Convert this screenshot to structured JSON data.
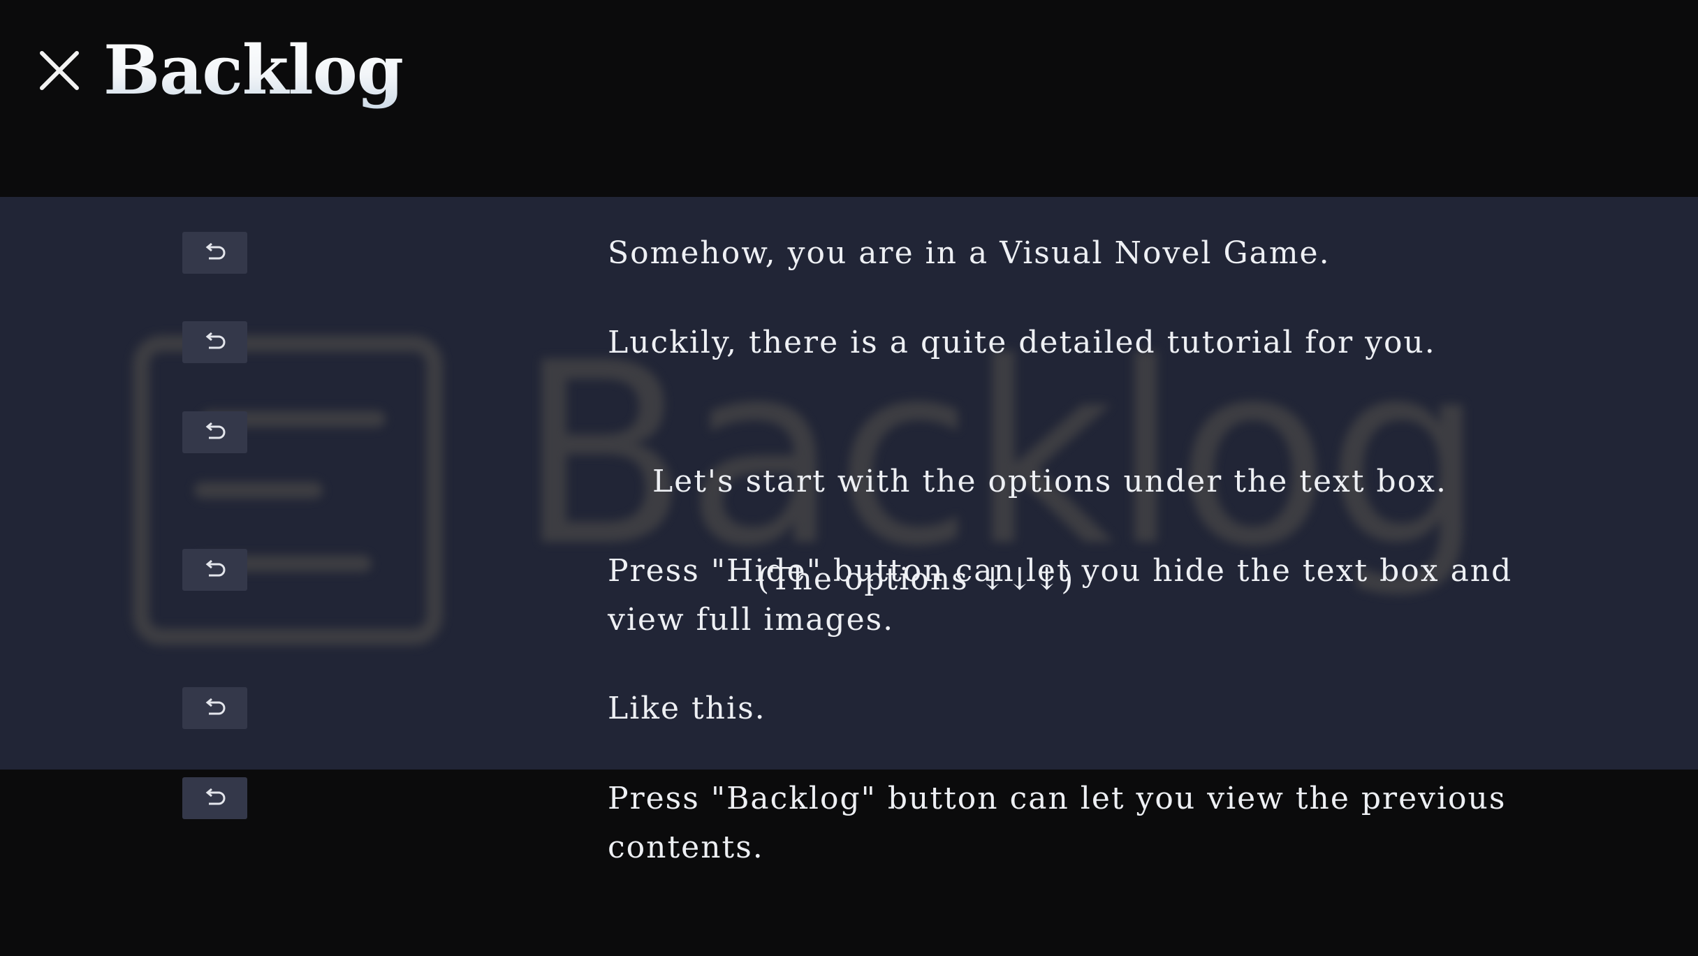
{
  "header": {
    "title": "Backlog",
    "close_icon": "close-icon"
  },
  "watermark": {
    "text": "Backlog",
    "icon": "backlog-list-icon"
  },
  "entries": [
    {
      "text": "Somehow, you are in a Visual Novel Game.",
      "replay_icon": "replay-icon"
    },
    {
      "text": "Luckily, there is a quite detailed tutorial for you.",
      "replay_icon": "replay-icon"
    },
    {
      "text": "Let's start with the options under the text box.",
      "text_line2": "(The options ↓↓↓)",
      "replay_icon": "replay-icon"
    },
    {
      "text": "Press \"Hide\" button can let you hide the text box and view full images.",
      "replay_icon": "replay-icon"
    },
    {
      "text": "Like this.",
      "replay_icon": "replay-icon"
    },
    {
      "text": "Press \"Backlog\" button can let you view the previous contents.",
      "replay_icon": "replay-icon"
    }
  ],
  "colors": {
    "background": "#0b0b0c",
    "panel": "#212536",
    "button": "#34384a",
    "text": "#eef0f4"
  }
}
